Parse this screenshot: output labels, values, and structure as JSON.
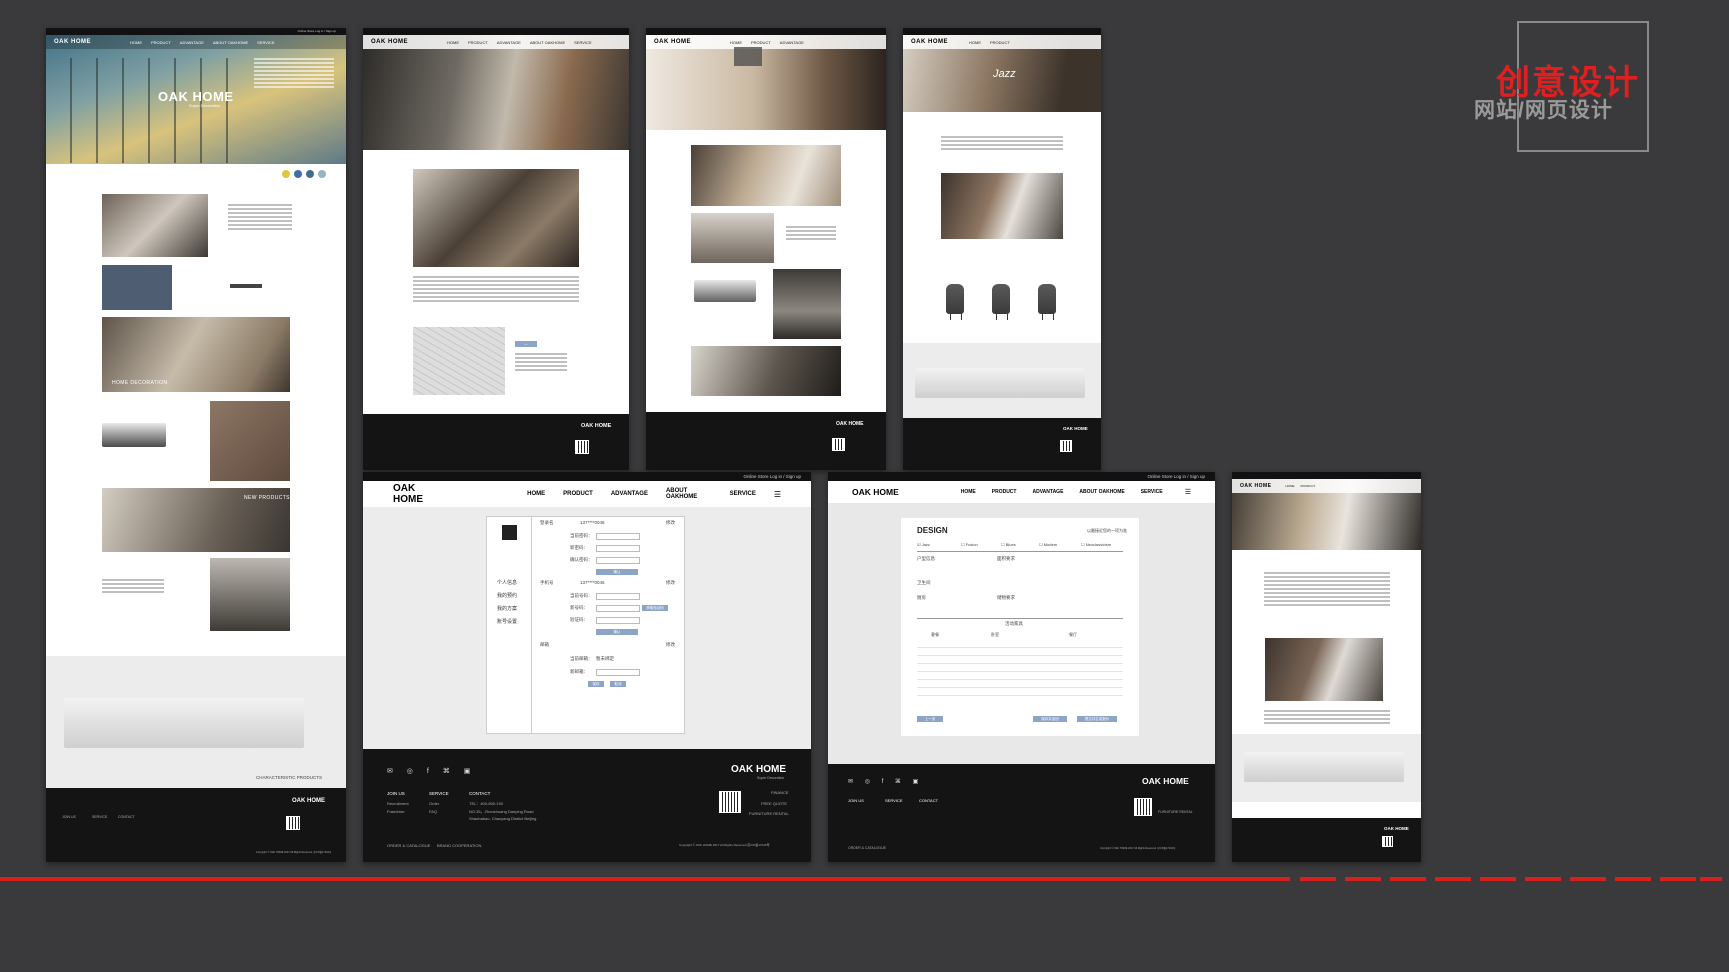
{
  "banner": {
    "title": "创意设计",
    "subtitle": "网站/网页设计",
    "accent": "#e02020"
  },
  "brand": {
    "logo": "OAK HOME",
    "tagline": "Super Decoration"
  },
  "topbar": {
    "links": "Online Store  Log in / Sign up"
  },
  "nav": [
    "HOME",
    "PRODUCT",
    "ADVANTAGE",
    "ABOUT OAKHOME",
    "SERVICE"
  ],
  "page1": {
    "hero_title": "OAK HOME",
    "hero_sub": "Super Decoration",
    "captions": [
      "HOME DECORATION",
      "NEW PRODUCTS",
      "CHARACTERISTIC PRODUCTS"
    ]
  },
  "page4": {
    "jazz": "Jazz"
  },
  "account": {
    "side_menu": [
      "个人信息",
      "我的预约",
      "我的方案",
      "账号设置"
    ],
    "sections": [
      "登录名",
      "手机号",
      "邮箱"
    ],
    "login_name_value": "137****0046",
    "phone_value": "137****0046",
    "row_labels": [
      "当前密码：",
      "新密码：",
      "确认密码：",
      "当前号码：",
      "新号码：",
      "验证码：",
      "当前邮箱：",
      "新邮箱："
    ],
    "edit_label": "修改",
    "confirm": "确认",
    "get_code": "获取验证码",
    "email_value": "暂未绑定",
    "save": "保存",
    "cancel": "取消"
  },
  "design_form": {
    "title": "DESIGN",
    "hint": "以最接近您的一项为准",
    "styles": [
      "Jazz",
      "Fusion",
      "Blues",
      "Modern",
      "Neoclassicism"
    ],
    "section_labels": [
      "户型信息",
      "面积要求",
      "卫生间",
      "厨房",
      "储物要求"
    ],
    "furniture_title": "活动家具",
    "furniture_cols": [
      "客餐",
      "卧室",
      "餐厅",
      "餐厅"
    ],
    "btn_left": "上一页",
    "btn_mid": "保存并返回",
    "btn_right": "提交并生成报价"
  },
  "footer": {
    "cols": [
      "JOIN US",
      "SERVICE",
      "CONTACT"
    ],
    "join_items": [
      "Recruitment",
      "Franchise"
    ],
    "service_items": [
      "Order",
      "FAQ"
    ],
    "contact_lines": [
      "TEL：400-800-190",
      "NO.35，Zhonzhuang Danping Road",
      "Shaobabao, Chaoyang District Beijing"
    ],
    "right_items": [
      "FINANCE",
      "FREE QUOTE",
      "FURNITURE RENTAL"
    ],
    "bottom_left": [
      "ORDER & CATALOGUE",
      "BRAND COOPERATION"
    ],
    "copyright": "Copyright © OAK HOME 2017  All Rights Reserved  京ICP备17016号"
  }
}
